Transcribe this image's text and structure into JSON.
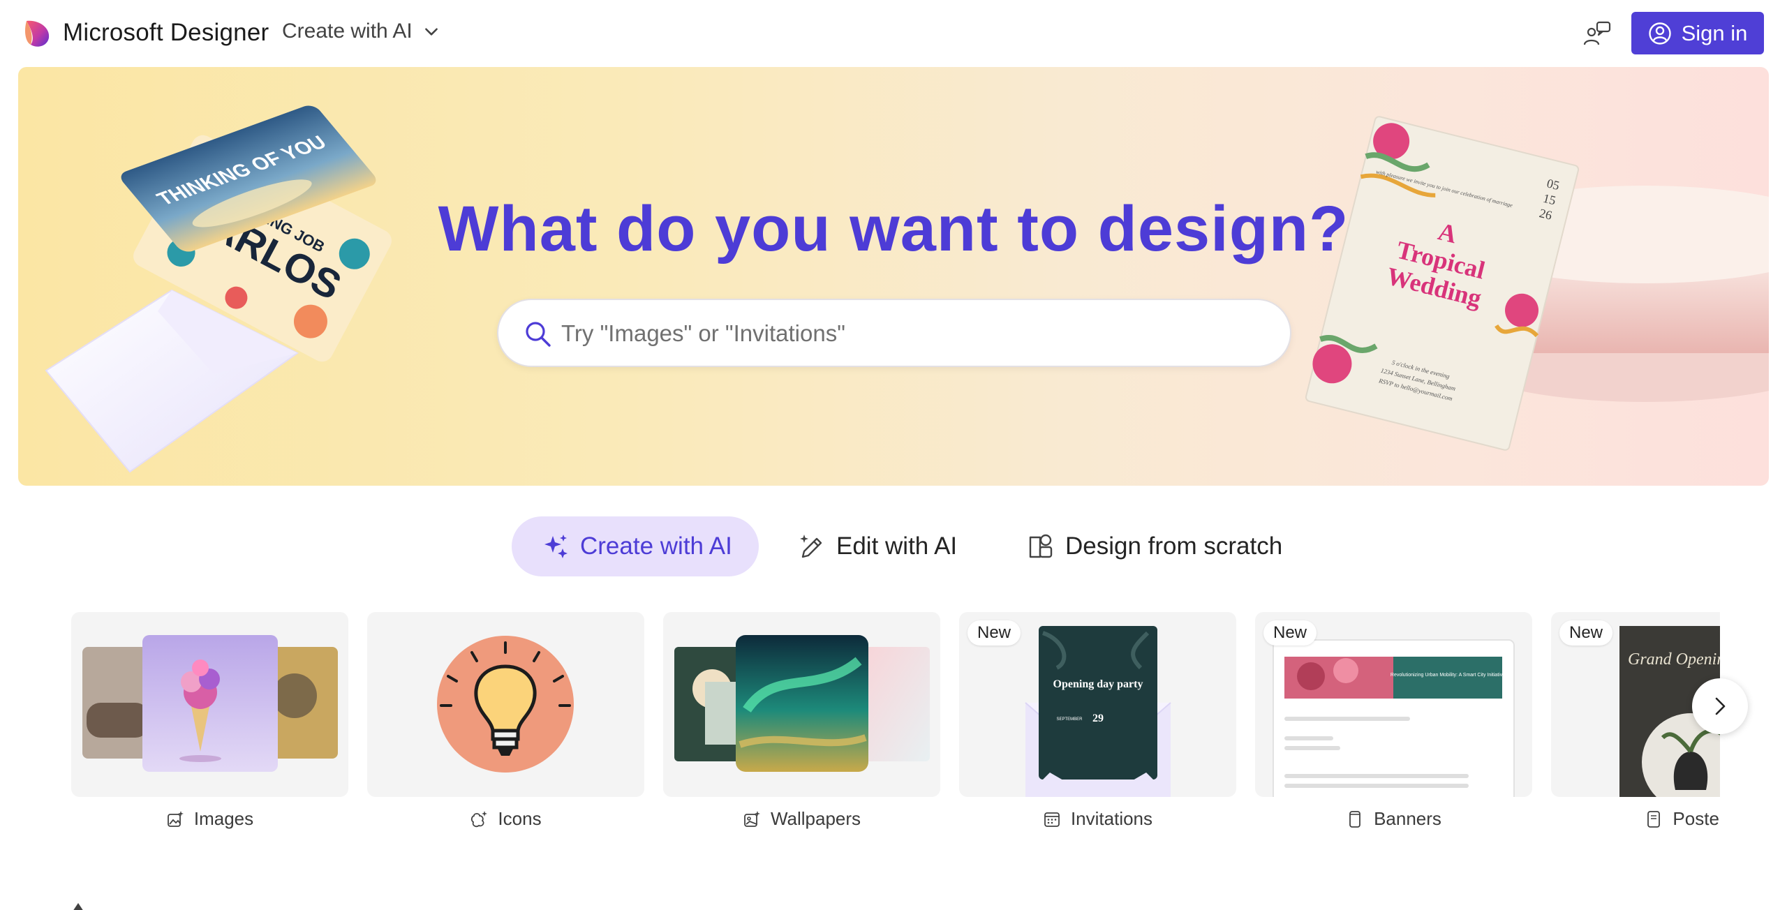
{
  "header": {
    "brand": "Microsoft Designer",
    "create_menu_label": "Create with AI",
    "signin_label": "Sign in"
  },
  "hero": {
    "title": "What do you want to design?",
    "search_placeholder": "Try \"Images\" or \"Invitations\"",
    "decor": {
      "card1_text": "THINKING OF YOU",
      "card2_line1": "AMAZING JOB",
      "card2_line2": "CARLOS",
      "invite_date": [
        "05",
        "15",
        "26"
      ],
      "invite_intro": "with pleasure we invite you to join our celebration of marriage",
      "invite_title": [
        "A",
        "Tropical",
        "Wedding"
      ],
      "invite_details": [
        "5 o'clock in the evening",
        "1234 Sunset Lane, Bellingham",
        "RSVP to hello@yourmail.com"
      ]
    }
  },
  "tabs": [
    {
      "label": "Create with AI",
      "icon": "sparkle-icon",
      "active": true
    },
    {
      "label": "Edit with AI",
      "icon": "pen-sparkle-icon",
      "active": false
    },
    {
      "label": "Design from scratch",
      "icon": "shapes-icon",
      "active": false
    }
  ],
  "cards": [
    {
      "label": "Images",
      "icon": "image-sparkle-icon",
      "badge": ""
    },
    {
      "label": "Icons",
      "icon": "icon-sparkle-icon",
      "badge": ""
    },
    {
      "label": "Wallpapers",
      "icon": "wallpaper-icon",
      "badge": ""
    },
    {
      "label": "Invitations",
      "icon": "calendar-icon",
      "badge": "New",
      "preview": {
        "title": "Opening day party",
        "month": "SEPTEMBER",
        "day": "29"
      }
    },
    {
      "label": "Banners",
      "icon": "phone-icon",
      "badge": "New",
      "preview": {
        "title": "Revolutionizing Urban Mobility: A Smart City Initiative"
      }
    },
    {
      "label": "Posters",
      "icon": "document-icon",
      "badge": "New",
      "preview": {
        "title": "Grand Opening"
      }
    }
  ],
  "colors": {
    "accent": "#4d3cd6",
    "signin_bg": "#4f3fd6",
    "active_tab_bg": "#e8e0fc",
    "card_bg": "#f4f4f4"
  }
}
